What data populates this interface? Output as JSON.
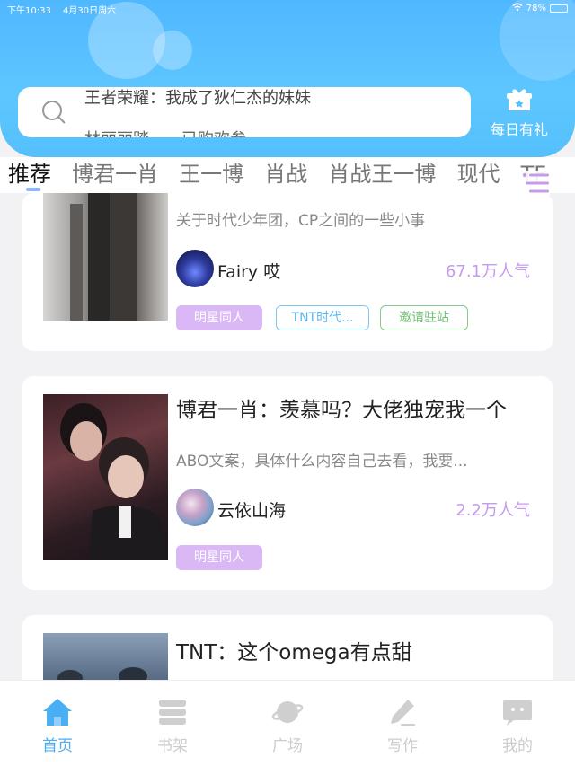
{
  "status": {
    "time": "下午10:33",
    "date": "4月30日周六",
    "battery": "78%"
  },
  "search": {
    "line1": "王者荣耀：我成了狄仁杰的妹妹",
    "line2": "林丽丽踏……已购欢参"
  },
  "daily": {
    "label": "每日有礼",
    "icon": "gift-icon"
  },
  "tabs": [
    "推荐",
    "博君一肖",
    "王一博",
    "肖战",
    "肖战王一博",
    "现代",
    "TF"
  ],
  "cards": [
    {
      "title": "",
      "desc": "关于时代少年团，CP之间的一些小事",
      "author": "Fairy 哎",
      "popularity": "67.1万人气",
      "tags": [
        {
          "label": "明星同人",
          "style": "purple"
        },
        {
          "label": "TNT时代...",
          "style": "blue"
        },
        {
          "label": "邀请驻站",
          "style": "green"
        }
      ]
    },
    {
      "title": "博君一肖：羡慕吗？大佬独宠我一个",
      "desc": "ABO文案，具体什么内容自己去看，我要...",
      "author": "云依山海",
      "popularity": "2.2万人气",
      "tags": [
        {
          "label": "明星同人",
          "style": "purple"
        }
      ]
    },
    {
      "title": "TNT：这个omega有点甜",
      "desc": "",
      "author": "",
      "popularity": "",
      "tags": []
    }
  ],
  "nav": [
    {
      "label": "首页",
      "icon": "home-icon",
      "active": true
    },
    {
      "label": "书架",
      "icon": "bookshelf-icon",
      "active": false
    },
    {
      "label": "广场",
      "icon": "planet-icon",
      "active": false
    },
    {
      "label": "写作",
      "icon": "pen-icon",
      "active": false
    },
    {
      "label": "我的",
      "icon": "chat-profile-icon",
      "active": false
    }
  ],
  "colors": {
    "accent": "#4aaef5",
    "header": "#54c0fc",
    "tag_purple": "#d9b8f5",
    "popularity": "#c49af0"
  }
}
